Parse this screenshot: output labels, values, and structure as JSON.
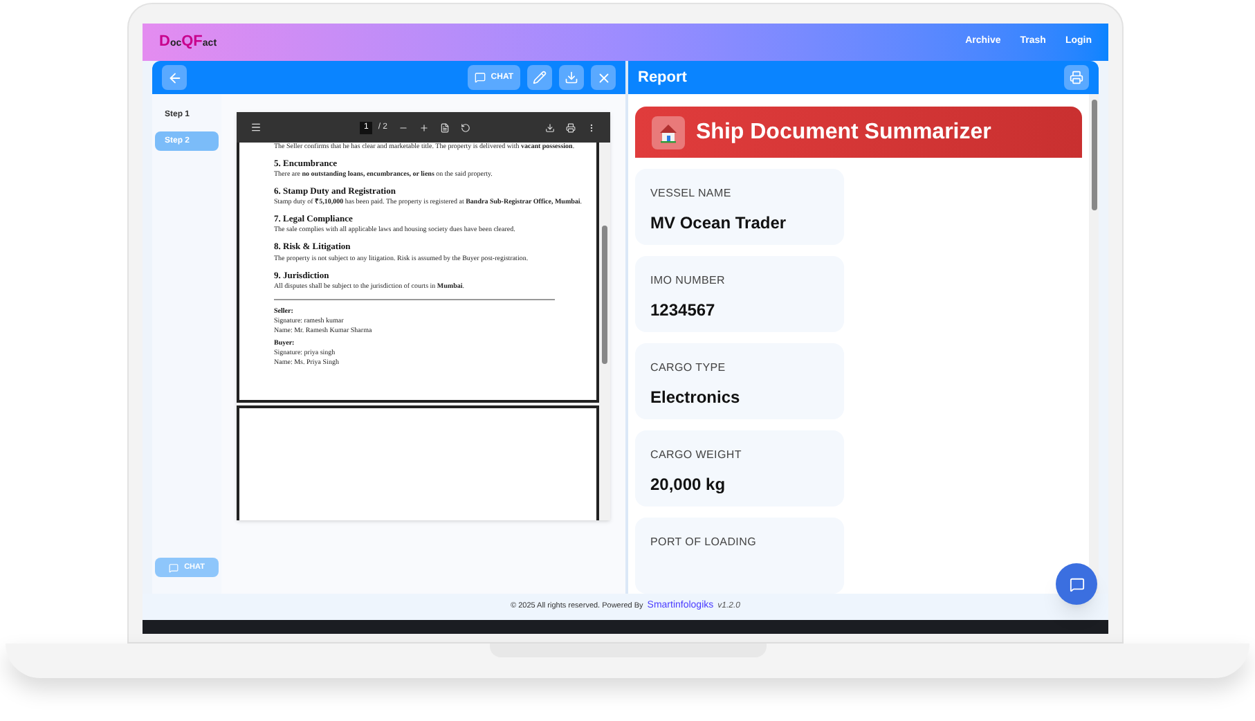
{
  "logo": [
    {
      "text": "D",
      "accent": true
    },
    {
      "text": "oc",
      "accent": false
    },
    {
      "text": "QF",
      "accent": true
    },
    {
      "text": "act",
      "accent": false
    }
  ],
  "nav": [
    "Archive",
    "Trash",
    "Login"
  ],
  "toolbar": {
    "chat_label": "CHAT"
  },
  "steps": [
    {
      "label": "Step 1",
      "selected": false
    },
    {
      "label": "Step 2",
      "selected": true
    }
  ],
  "sidebar_chat": {
    "label": "CHAT",
    "disabled": true
  },
  "pdf_viewer": {
    "page": "1",
    "total": "/ 2",
    "blocks": [
      {
        "kind": "para",
        "text": "The Seller confirms that he has clear and marketable title. The property is delivered with **vacant possession**."
      },
      {
        "kind": "heading",
        "text": "5. Encumbrance"
      },
      {
        "kind": "para",
        "text": "There are **no outstanding loans, encumbrances, or liens** on the said property."
      },
      {
        "kind": "heading",
        "text": "6. Stamp Duty and Registration"
      },
      {
        "kind": "para",
        "text": "Stamp duty of **₹5,10,000** has been paid. The property is registered at **Bandra Sub-Registrar Office, Mumbai**."
      },
      {
        "kind": "heading",
        "text": "7. Legal Compliance"
      },
      {
        "kind": "para",
        "text": "The sale complies with all applicable laws and housing society dues have been cleared."
      },
      {
        "kind": "heading",
        "text": "8. Risk & Litigation"
      },
      {
        "kind": "para",
        "text": "The property is not subject to any litigation. Risk is assumed by the Buyer post-registration."
      },
      {
        "kind": "heading",
        "text": "9. Jurisdiction"
      },
      {
        "kind": "para",
        "text": "All disputes shall be subject to the jurisdiction of courts in **Mumbai**."
      },
      {
        "kind": "rule"
      },
      {
        "kind": "label",
        "text": "Seller:"
      },
      {
        "kind": "line",
        "text": "Signature: ramesh kumar"
      },
      {
        "kind": "line",
        "text": "Name: Mr. Ramesh Kumar Sharma"
      },
      {
        "kind": "label",
        "text": "Buyer:"
      },
      {
        "kind": "line",
        "text": "Signature: priya singh"
      },
      {
        "kind": "line",
        "text": "Name: Ms. Priya Singh"
      }
    ]
  },
  "report": {
    "title": "Report",
    "summary_title": "Ship Document Summarizer",
    "fields": [
      {
        "label": "VESSEL NAME",
        "value": "MV Ocean Trader"
      },
      {
        "label": "IMO NUMBER",
        "value": "1234567"
      },
      {
        "label": "CARGO TYPE",
        "value": "Electronics"
      },
      {
        "label": "CARGO WEIGHT",
        "value": "20,000 kg"
      },
      {
        "label": "PORT OF LOADING"
      }
    ]
  },
  "footer": {
    "text": "© 2025 All rights reserved. Powered By",
    "link": "Smartinfologiks",
    "version": "v1.2.0"
  }
}
